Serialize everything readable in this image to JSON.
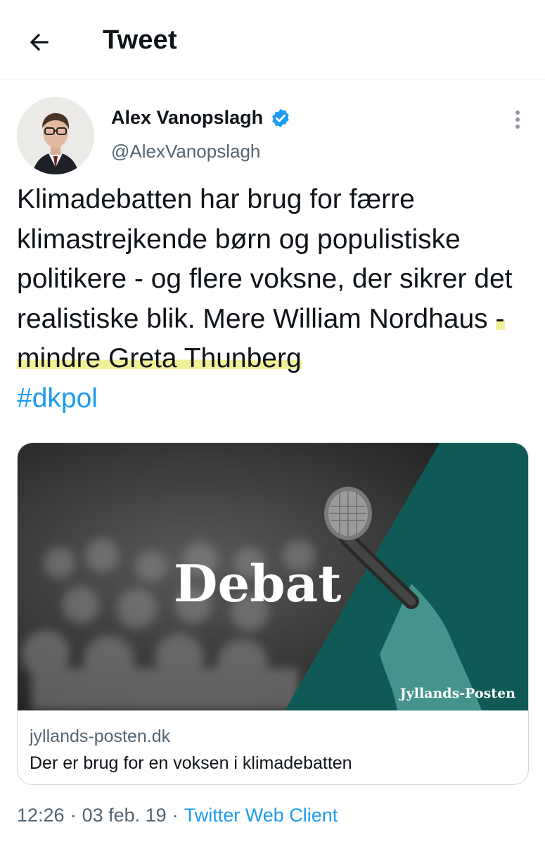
{
  "header": {
    "back_icon": "arrow-left-icon",
    "title": "Tweet"
  },
  "author": {
    "display_name": "Alex Vanopslagh",
    "verified_icon": "verified-badge-icon",
    "handle": "@AlexVanopslagh",
    "more_icon": "more-vertical-icon"
  },
  "tweet": {
    "text_before_highlight": "Klimadebatten har brug for færre klimastrejkende børn og populistiske politikere - og flere voksne, der sikrer det realistiske blik. Mere William Nordhaus ",
    "text_highlighted": "- mindre Greta Thunberg",
    "hashtag": "#dkpol"
  },
  "card": {
    "image_headline": "Debat",
    "image_brand": "Jyllands-Posten",
    "domain": "jyllands-posten.dk",
    "title": "Der er brug for en voksen i klimadebatten"
  },
  "meta": {
    "time": "12:26",
    "separator": "·",
    "date": "03 feb. 19",
    "source": "Twitter Web Client"
  },
  "colors": {
    "accent": "#1d9bf0",
    "muted_text": "#536471",
    "highlight": "#f2ef9a",
    "card_teal": "#0f5a56"
  }
}
